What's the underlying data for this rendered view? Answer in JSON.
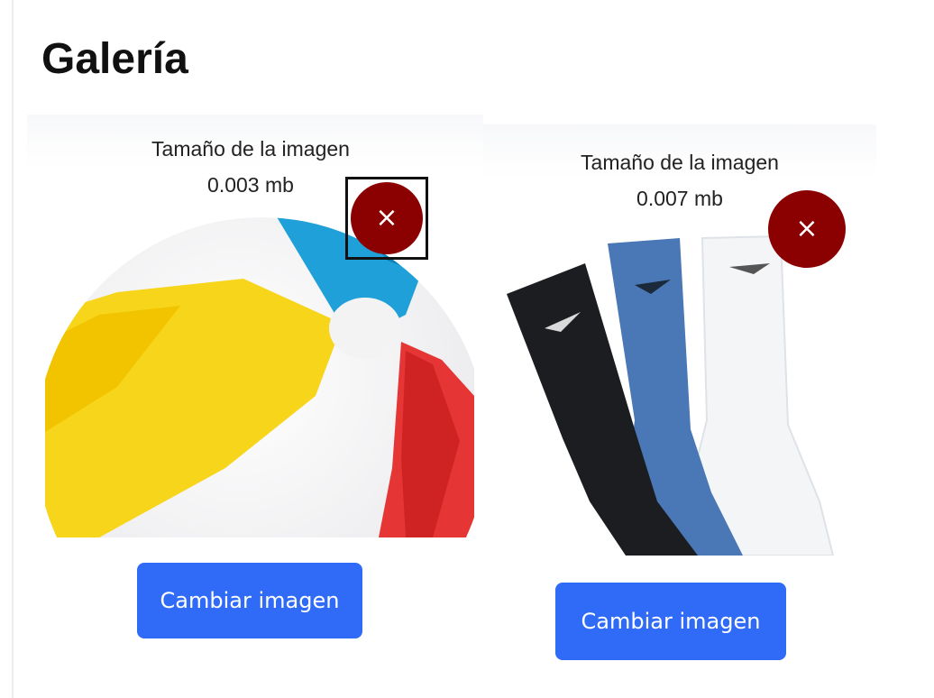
{
  "page": {
    "title": "Galería"
  },
  "gallery": {
    "items": [
      {
        "size_label": "Tamaño de la imagen",
        "size_value": "0.003 mb",
        "image_icon": "beach-ball-image",
        "remove_icon": "×",
        "change_label": "Cambiar imagen"
      },
      {
        "size_label": "Tamaño de la imagen",
        "size_value": "0.007 mb",
        "image_icon": "socks-image",
        "remove_icon": "×",
        "change_label": "Cambiar imagen"
      }
    ]
  },
  "colors": {
    "accent_blue": "#2f6bf6",
    "remove_red": "#8b0000",
    "text": "#111111"
  }
}
